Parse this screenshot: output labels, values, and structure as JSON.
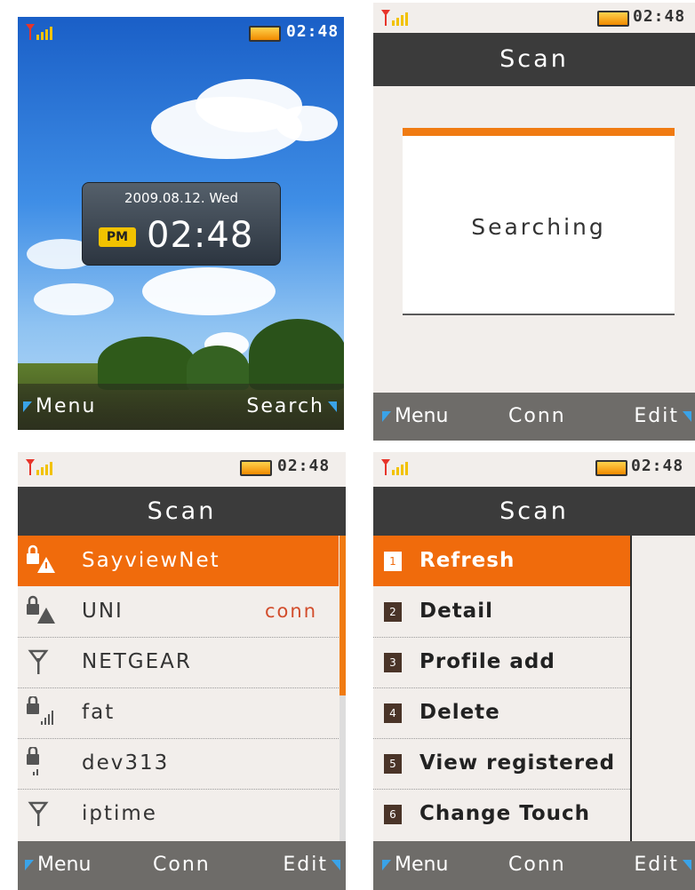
{
  "colors": {
    "accent": "#f06b0c",
    "titlebar": "#3b3b3b",
    "softkeys": "#6e6c69",
    "status_conn": "#d24c2b"
  },
  "home": {
    "clock": "02:48",
    "date": "2009.08.12. Wed",
    "ampm": "PM",
    "time": "02:48",
    "softkeys": {
      "left": "Menu",
      "right": "Search"
    }
  },
  "searching": {
    "clock": "02:48",
    "title": "Scan",
    "message": "Searching",
    "softkeys": {
      "left": "Menu",
      "center": "Conn",
      "right": "Edit"
    }
  },
  "results": {
    "clock": "02:48",
    "title": "Scan",
    "networks": [
      {
        "name": "SayviewNet",
        "status": "",
        "icon": "lock-warning-icon"
      },
      {
        "name": "UNI",
        "status": "conn",
        "icon": "lock-warning-icon"
      },
      {
        "name": "NETGEAR",
        "status": "",
        "icon": "antenna-icon"
      },
      {
        "name": "fat",
        "status": "",
        "icon": "lock-signal-icon"
      },
      {
        "name": "dev313",
        "status": "",
        "icon": "lock-signal-icon"
      },
      {
        "name": "iptime",
        "status": "",
        "icon": "antenna-icon"
      }
    ],
    "softkeys": {
      "left": "Menu",
      "center": "Conn",
      "right": "Edit"
    }
  },
  "options": {
    "clock": "02:48",
    "title": "Scan",
    "items": [
      {
        "num": "1",
        "label": "Refresh"
      },
      {
        "num": "2",
        "label": "Detail"
      },
      {
        "num": "3",
        "label": "Profile add"
      },
      {
        "num": "4",
        "label": "Delete"
      },
      {
        "num": "5",
        "label": "View registered"
      },
      {
        "num": "6",
        "label": "Change Touch"
      }
    ],
    "softkeys": {
      "left": "Menu",
      "center": "Conn",
      "right": "Edit"
    }
  }
}
